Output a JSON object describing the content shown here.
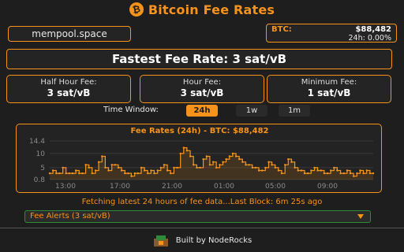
{
  "header": {
    "title": "Bitcoin Fee Rates",
    "logo_glyph": "₿",
    "logo_icon": "bitcoin-icon"
  },
  "source": {
    "label": "mempool.space"
  },
  "price": {
    "label": "BTC:",
    "value": "$88,482",
    "change": "24h: 0.00%"
  },
  "fastest": {
    "text": "Fastest Fee Rate: 3 sat/vB"
  },
  "fees": [
    {
      "label": "Half Hour Fee:",
      "value": "3 sat/vB"
    },
    {
      "label": "Hour Fee:",
      "value": "3 sat/vB"
    },
    {
      "label": "Minimum Fee:",
      "value": "1 sat/vB"
    }
  ],
  "time_window": {
    "label": "Time Window:",
    "options": [
      "24h",
      "1w",
      "1m"
    ],
    "selected": "24h"
  },
  "status": {
    "text": "Fetching latest 24 hours of fee data...Last Block: 6m 25s ago"
  },
  "alerts": {
    "selected": "Fee Alerts (3 sat/vB)"
  },
  "footer": {
    "text": "Built by NodeRocks"
  },
  "colors": {
    "accent": "#f7931a",
    "background": "#1e1e1e",
    "alerts_border": "#2e8b3a"
  },
  "chart_data": {
    "type": "line",
    "title": "Fee Rates (24h) - BTC: $88,482",
    "y_ticks": [
      "14.4",
      "10",
      "5",
      "0.8"
    ],
    "x_ticks": [
      "13:00",
      "17:00",
      "21:00",
      "01:00",
      "05:00",
      "09:00"
    ],
    "ylim": [
      0.8,
      14.4
    ],
    "grid": true,
    "x": [
      0,
      1,
      2,
      3,
      4,
      5,
      6,
      7,
      8,
      9,
      10,
      11,
      12,
      13,
      14,
      15,
      16,
      17,
      18,
      19,
      20,
      21,
      22,
      23,
      24,
      25,
      26,
      27,
      28,
      29,
      30,
      31,
      32,
      33,
      34,
      35,
      36,
      37,
      38,
      39,
      40,
      41,
      42,
      43,
      44,
      45,
      46,
      47,
      48,
      49,
      50,
      51,
      52,
      53,
      54,
      55,
      56,
      57,
      58,
      59,
      60,
      61,
      62,
      63,
      64,
      65,
      66,
      67,
      68,
      69,
      70,
      71,
      72,
      73,
      74,
      75,
      76,
      77,
      78,
      79,
      80,
      81,
      82,
      83,
      84,
      85,
      86,
      87,
      88,
      89,
      90,
      91,
      92,
      93,
      94,
      95,
      96,
      97,
      98,
      99
    ],
    "values": [
      3,
      4,
      3,
      3,
      5,
      3,
      3,
      3,
      4,
      3,
      3,
      6,
      5,
      3,
      4,
      7,
      9,
      5,
      4,
      6,
      6,
      5,
      4,
      3,
      3,
      2,
      3,
      3,
      5,
      4,
      3,
      4,
      3,
      4,
      5,
      6,
      4,
      3,
      5,
      5,
      10,
      12,
      11,
      9,
      6,
      5,
      5,
      8,
      9,
      6,
      7,
      5,
      6,
      7,
      8,
      9,
      10,
      9,
      8,
      7,
      6,
      6,
      5,
      5,
      4,
      4,
      5,
      7,
      6,
      5,
      4,
      3,
      6,
      8,
      7,
      5,
      4,
      4,
      3,
      3,
      4,
      5,
      4,
      4,
      3,
      3,
      4,
      5,
      4,
      3,
      3,
      4,
      3,
      2,
      3,
      4,
      3,
      4,
      3,
      3
    ]
  }
}
